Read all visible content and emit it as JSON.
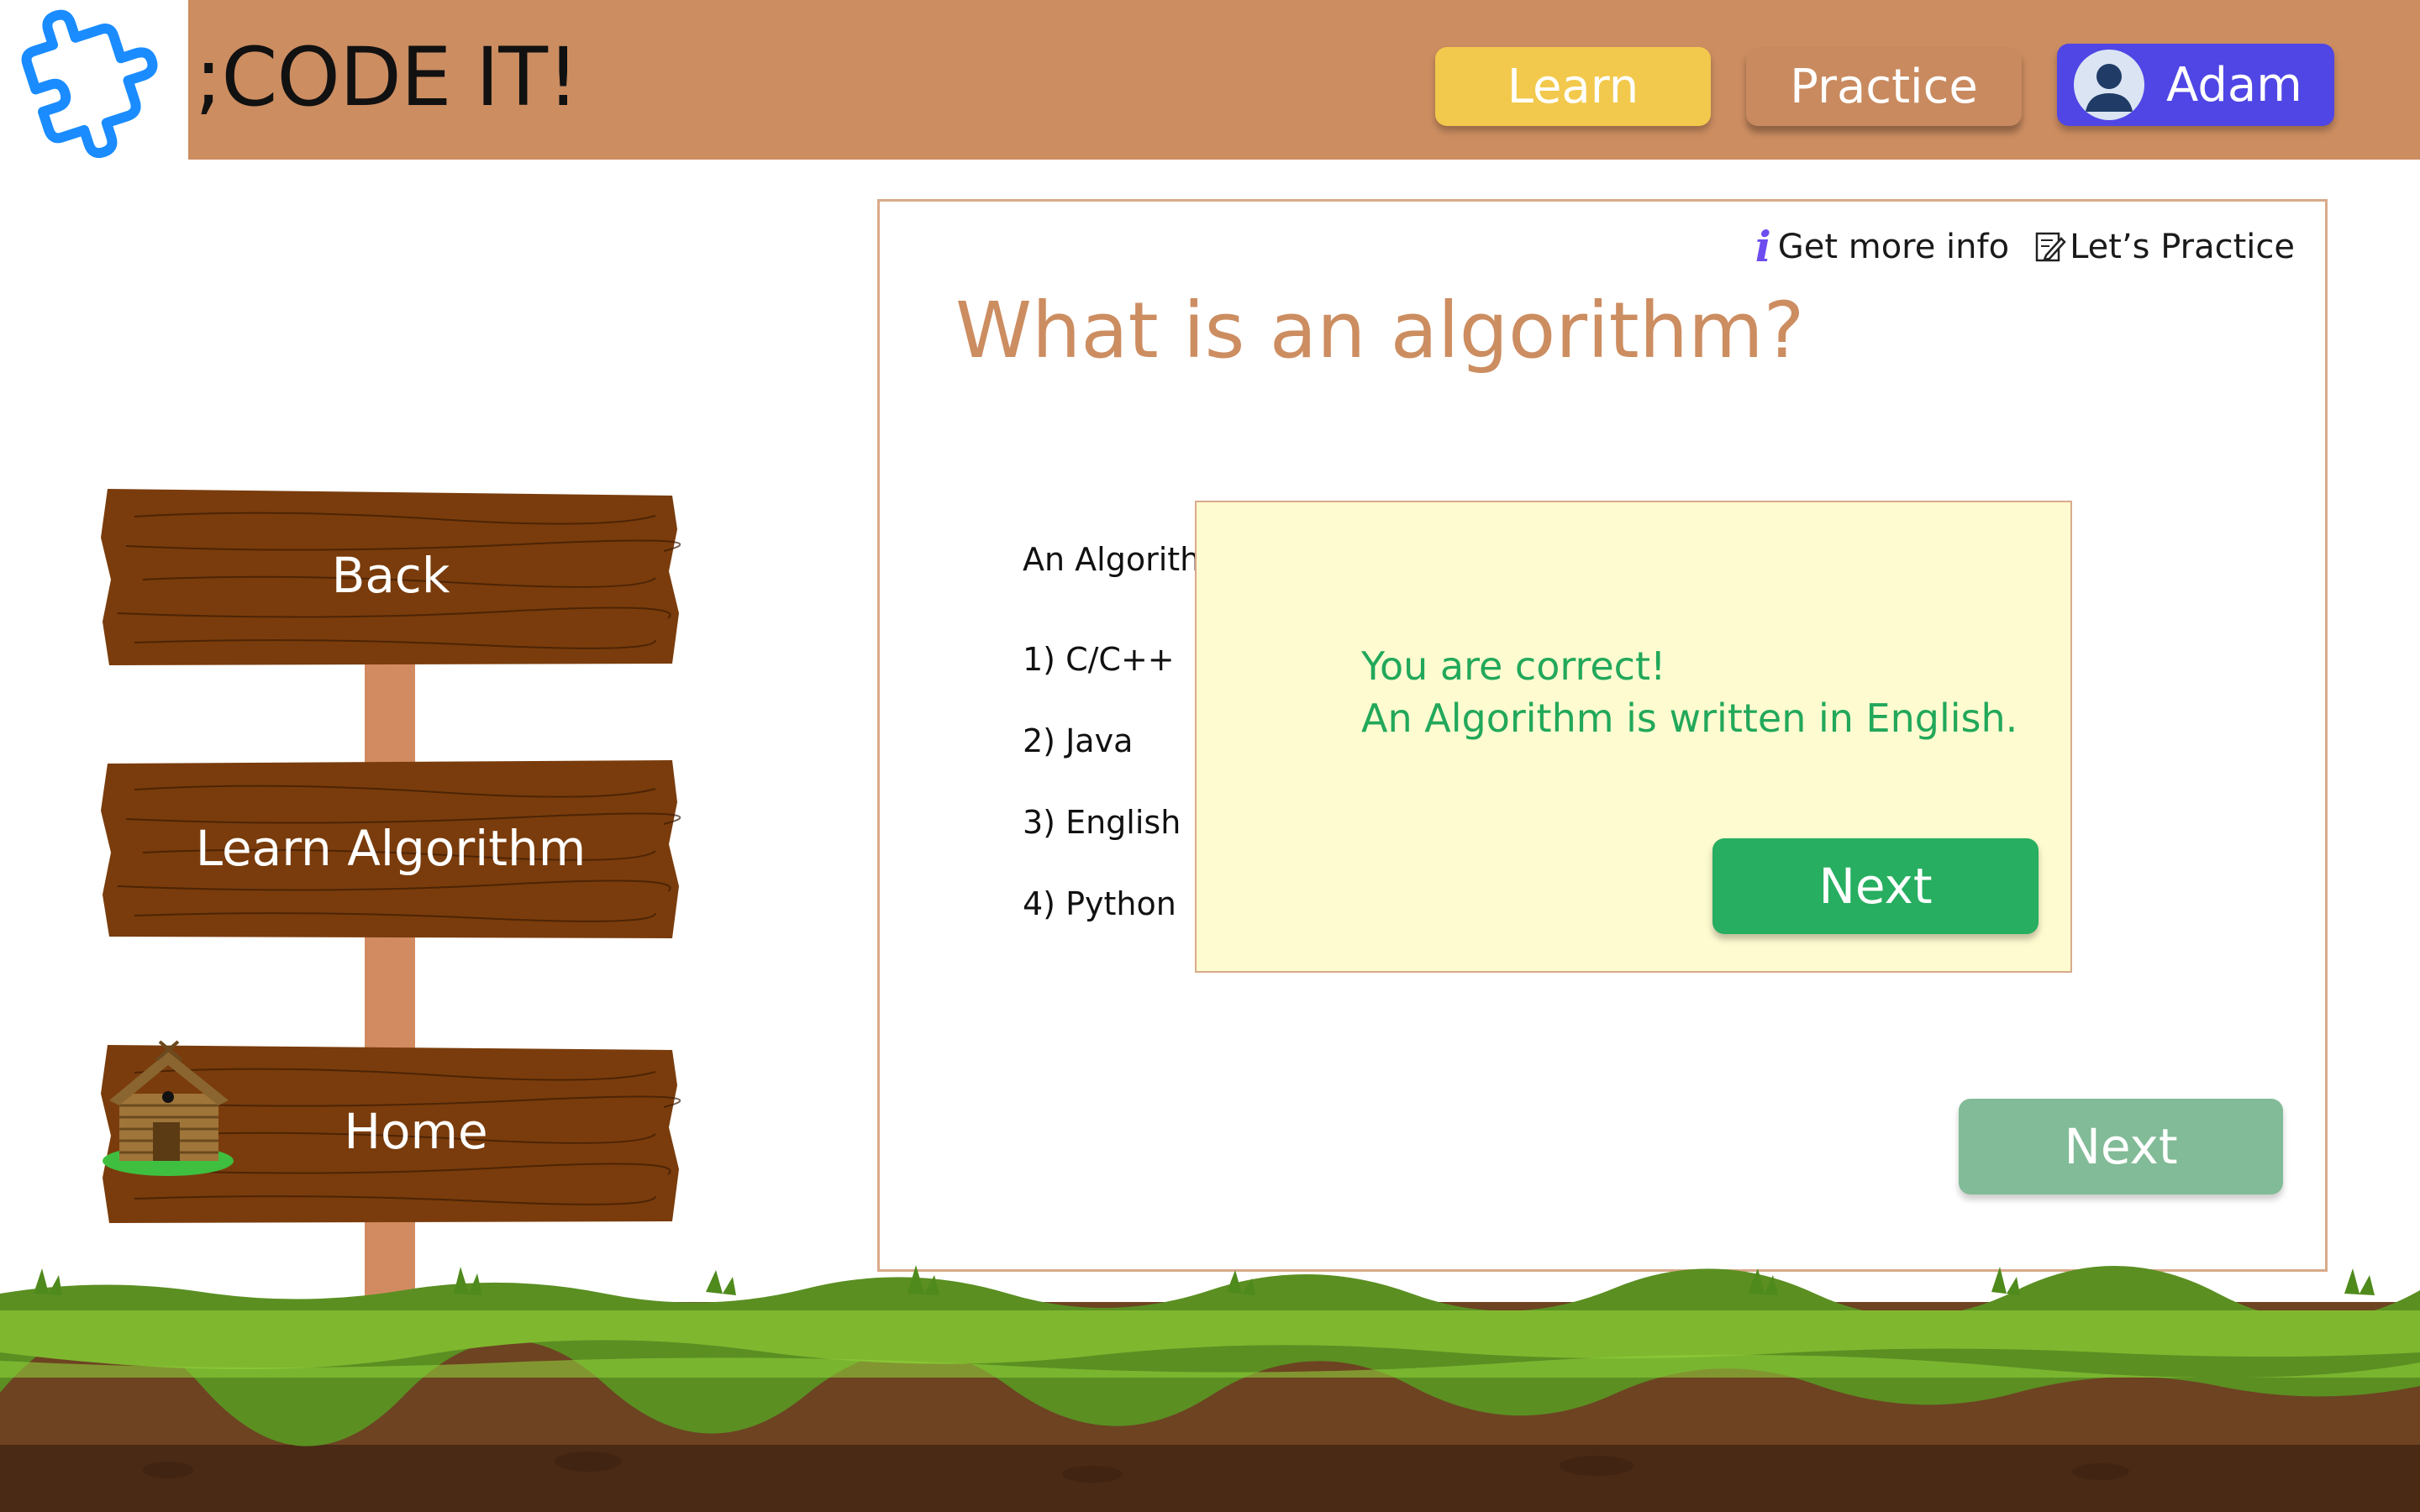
{
  "header": {
    "brand": ";CODE IT!",
    "nav": {
      "learn": "Learn",
      "practice": "Practice"
    },
    "user": {
      "name": "Adam"
    }
  },
  "signpost": {
    "back": "Back",
    "learn_algorithm": "Learn Algorithm",
    "home": "Home"
  },
  "panel": {
    "links": {
      "more_info": "Get more info",
      "practice": "Let’s Practice"
    },
    "title": "What is an algorithm?",
    "question": "An Algorithm",
    "options": [
      "1) C/C++",
      "2) Java",
      "3) English",
      "4) Python"
    ],
    "next_label": "Next"
  },
  "feedback": {
    "line1": "You are correct!",
    "line2": "An Algorithm is written in English.",
    "next_label": "Next"
  },
  "colors": {
    "header": "#cc8d61",
    "learn": "#f2c94c",
    "user": "#4f46e5",
    "correct": "#27ae60",
    "modal_bg": "#fefbd0"
  },
  "icons": {
    "logo": "puzzle-icon",
    "avatar": "user-avatar-icon",
    "info": "info-icon",
    "practice": "edit-note-icon",
    "home": "hut-icon"
  }
}
